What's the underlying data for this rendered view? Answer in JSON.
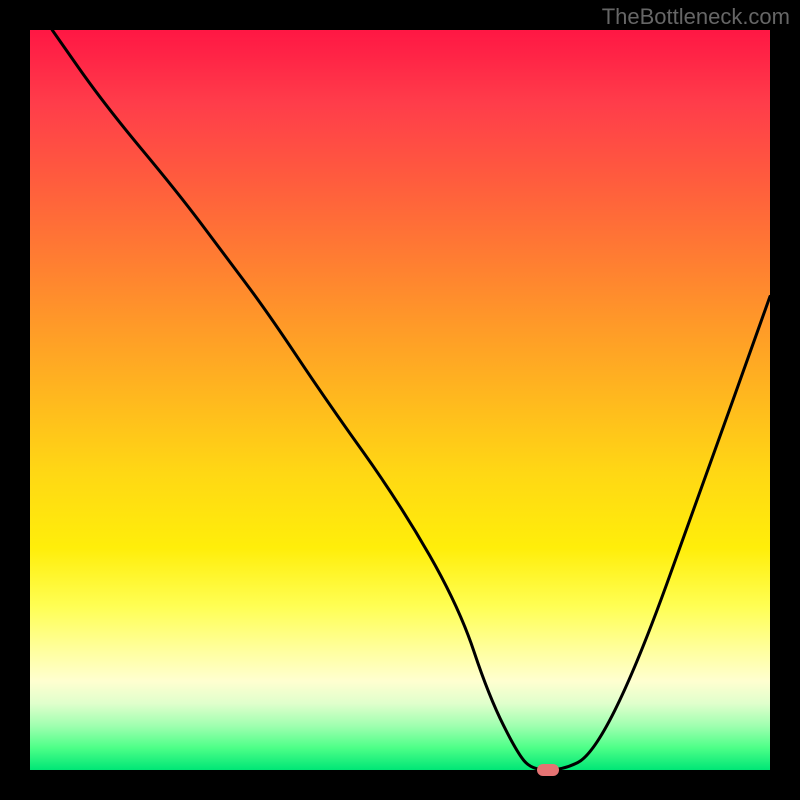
{
  "watermark": "TheBottleneck.com",
  "chart_data": {
    "type": "line",
    "title": "",
    "xlabel": "",
    "ylabel": "",
    "xlim": [
      0,
      100
    ],
    "ylim": [
      0,
      100
    ],
    "series": [
      {
        "name": "curve",
        "x": [
          3,
          10,
          20,
          26,
          32,
          40,
          50,
          58,
          62,
          66,
          68,
          72,
          76,
          82,
          90,
          100
        ],
        "y": [
          100,
          90,
          78,
          70,
          62,
          50,
          36,
          22,
          10,
          2,
          0,
          0,
          2,
          14,
          36,
          64
        ]
      }
    ],
    "marker": {
      "x": 70,
      "y": 0,
      "color": "#e57373"
    },
    "gradient_stops": [
      {
        "pos": 0,
        "color": "#ff1744"
      },
      {
        "pos": 50,
        "color": "#ffb91e"
      },
      {
        "pos": 80,
        "color": "#ffff55"
      },
      {
        "pos": 100,
        "color": "#00e676"
      }
    ]
  }
}
